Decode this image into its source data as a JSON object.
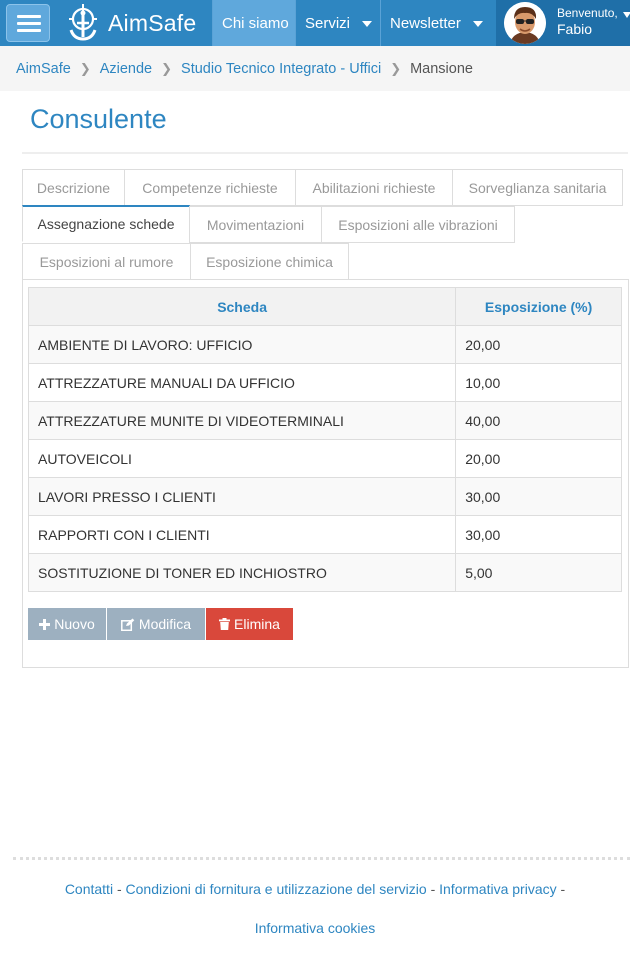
{
  "navbar": {
    "brand": "AimSafe",
    "items": [
      {
        "label": "Chi siamo",
        "active": true
      },
      {
        "label": "Servizi",
        "dropdown": true
      },
      {
        "label": "Newsletter",
        "dropdown": true
      }
    ],
    "user": {
      "welcome": "Benvenuto,",
      "name": "Fabio"
    },
    "colors": {
      "primary": "#2e86c1",
      "active": "#5fa8dc",
      "user_bg": "#1f6fa8"
    }
  },
  "breadcrumb": [
    "AimSafe",
    "Aziende",
    "Studio Tecnico Integrato - Uffici",
    "Mansione"
  ],
  "page": {
    "title": "Consulente"
  },
  "tabs": [
    {
      "label": "Descrizione",
      "active": false
    },
    {
      "label": "Competenze richieste",
      "active": false
    },
    {
      "label": "Abilitazioni richieste",
      "active": false
    },
    {
      "label": "Sorveglianza sanitaria",
      "active": false
    },
    {
      "label": "Assegnazione schede",
      "active": true
    },
    {
      "label": "Movimentazioni",
      "active": false
    },
    {
      "label": "Esposizioni alle vibrazioni",
      "active": false
    },
    {
      "label": "Esposizioni al rumore",
      "active": false
    },
    {
      "label": "Esposizione chimica",
      "active": false
    }
  ],
  "table": {
    "columns": [
      "Scheda",
      "Esposizione (%)"
    ],
    "rows": [
      [
        "AMBIENTE DI LAVORO: UFFICIO",
        "20,00"
      ],
      [
        "ATTREZZATURE MANUALI DA UFFICIO",
        "10,00"
      ],
      [
        "ATTREZZATURE MUNITE DI VIDEOTERMINALI",
        "40,00"
      ],
      [
        "AUTOVEICOLI",
        "20,00"
      ],
      [
        "LAVORI PRESSO I CLIENTI",
        "30,00"
      ],
      [
        "RAPPORTI CON I CLIENTI",
        "30,00"
      ],
      [
        "SOSTITUZIONE DI TONER ED INCHIOSTRO",
        "5,00"
      ]
    ]
  },
  "actions": {
    "new": {
      "label": "Nuovo",
      "icon": "plus-icon"
    },
    "edit": {
      "label": "Modifica",
      "icon": "edit-icon"
    },
    "delete": {
      "label": "Elimina",
      "icon": "trash-icon",
      "color": "#d9483b"
    }
  },
  "footer": {
    "links": [
      "Contatti",
      "Condizioni di fornitura e utilizzazione del servizio",
      "Informativa privacy",
      "Informativa cookies"
    ],
    "separator": "-"
  }
}
